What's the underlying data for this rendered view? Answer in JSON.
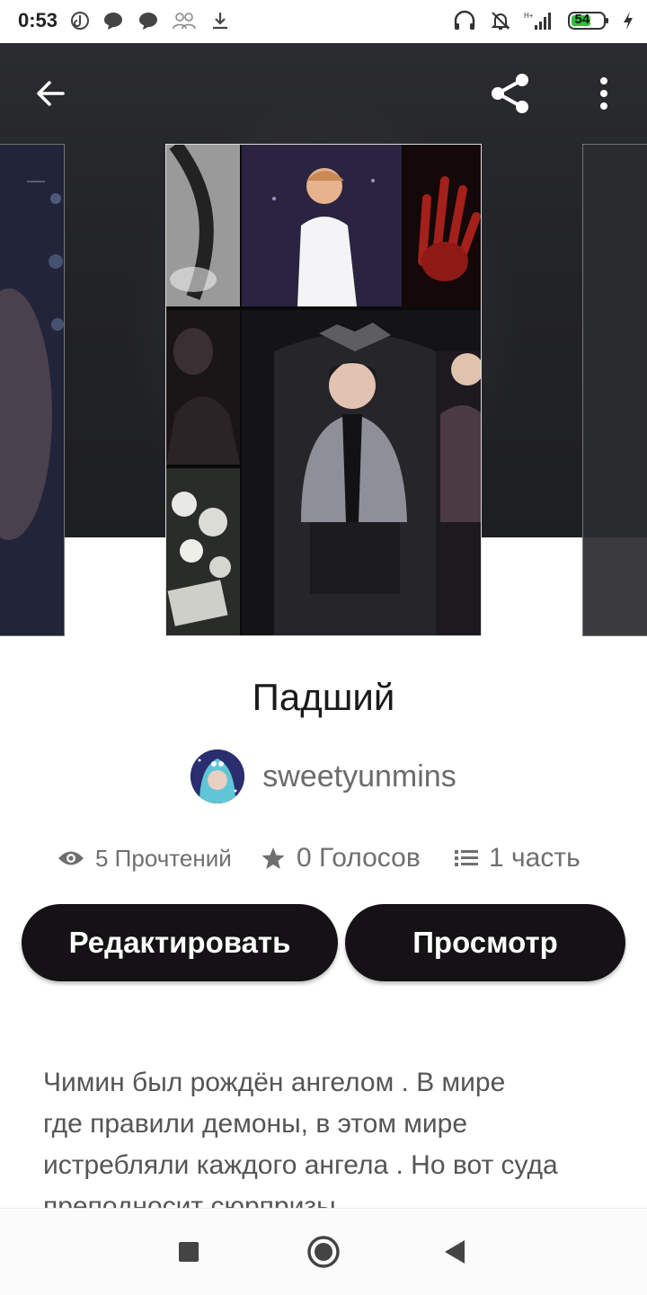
{
  "status_bar": {
    "time": "0:53",
    "battery": "54",
    "left_icons": [
      "tiktok-icon",
      "chat-bubble-icon",
      "chat-bubble-icon",
      "people-icon",
      "download-icon"
    ],
    "right_icons": [
      "headphones-icon",
      "bell-off-icon",
      "signal-icon",
      "battery-icon",
      "charging-icon"
    ]
  },
  "toolbar": {
    "back_icon": "arrow-left-icon",
    "share_icon": "share-icon",
    "menu_icon": "more-vert-icon"
  },
  "story": {
    "title": "Падший",
    "author": "sweetyunmins"
  },
  "stats": {
    "reads": "5 Прочтений",
    "votes": "0 Голосов",
    "parts": "1 часть"
  },
  "actions": {
    "edit_label": "Редактировать",
    "view_label": "Просмотр"
  },
  "description": {
    "line1": "Чимин был рождён ангелом . В мире",
    "line2": "где правили демоны, в этом мире",
    "line3": "истребляли каждого ангела . Но вот суда",
    "line4": "преподносит сюрпризы"
  },
  "colors": {
    "button_bg": "#141214",
    "hero_bg": "#232427",
    "stat_text": "#6f6f6f"
  }
}
